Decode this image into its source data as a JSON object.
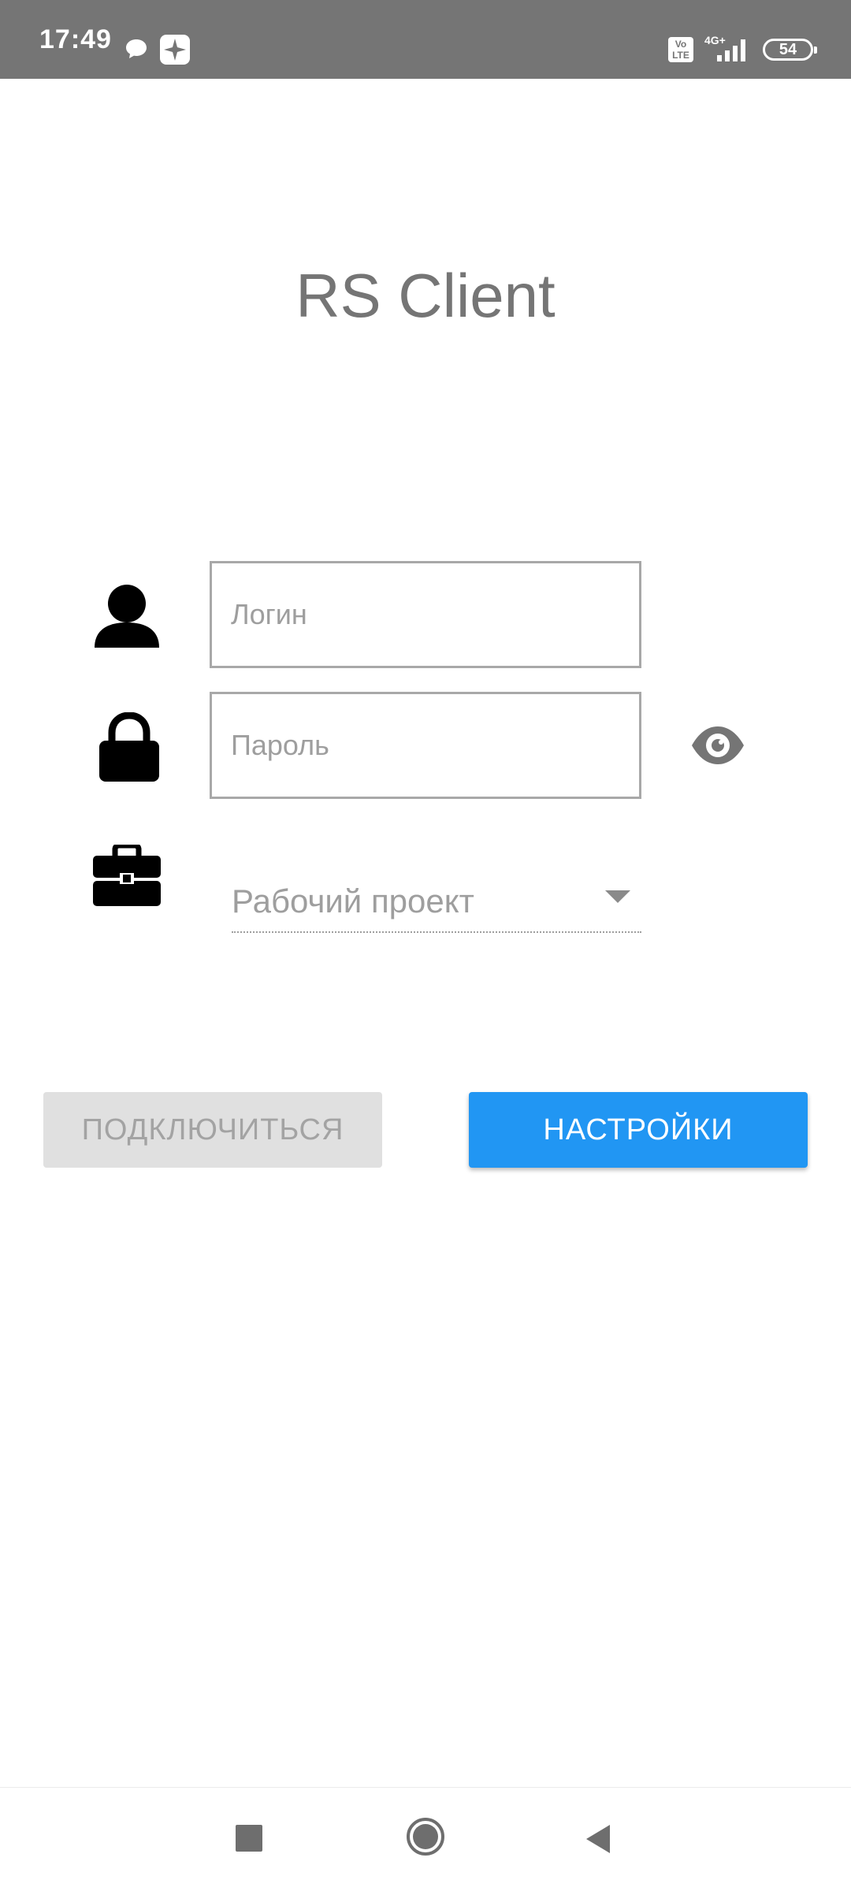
{
  "status_bar": {
    "time": "17:49",
    "volte": "Vo LTE",
    "network": "4G+",
    "battery": "54",
    "icons": [
      "chat-icon",
      "app-notification-icon",
      "volte-icon",
      "signal-icon",
      "battery-icon"
    ]
  },
  "app": {
    "title": "RS Client"
  },
  "form": {
    "login": {
      "placeholder": "Логин",
      "value": "",
      "icon": "user-icon"
    },
    "password": {
      "placeholder": "Пароль",
      "value": "",
      "icon": "lock-icon",
      "toggle_icon": "eye-icon"
    },
    "project": {
      "label": "Рабочий проект",
      "icon": "briefcase-icon"
    }
  },
  "buttons": {
    "connect_label": "ПОДКЛЮЧИТЬСЯ",
    "settings_label": "НАСТРОЙКИ"
  },
  "colors": {
    "status_bar": "#757575",
    "accent": "#2196f3",
    "disabled_button": "#e0e0e0",
    "title_text": "#757575"
  },
  "nav_bar": {
    "icons": [
      "recent-apps-icon",
      "home-icon",
      "back-icon"
    ]
  }
}
